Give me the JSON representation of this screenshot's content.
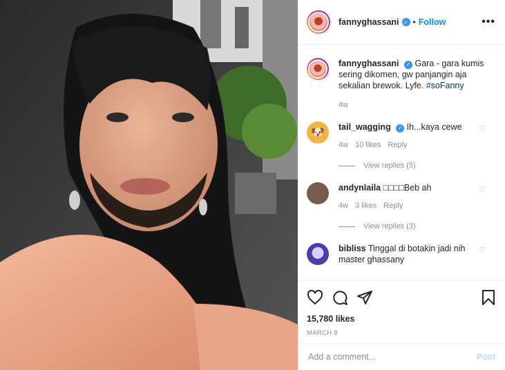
{
  "post": {
    "username": "fannyghassani",
    "follow_label": "Follow",
    "dot": "•",
    "more_icon": "more-options-icon",
    "caption_username": "fannyghassani",
    "caption_text": "Gara - gara kumis sering dikomen, gw panjangin aja sekalian brewok. Lyfe.",
    "caption_hashtag": "#soFanny",
    "caption_time": "4w"
  },
  "comments": [
    {
      "username": "tail_wagging",
      "verified": true,
      "text": "Ih...kaya cewe",
      "time": "4w",
      "likes": "10 likes",
      "reply": "Reply",
      "view_replies": "View replies (5)",
      "avatar_color": "#f2b440"
    },
    {
      "username": "andynlaila",
      "verified": false,
      "text": "□□□□Beb ah",
      "time": "4w",
      "likes": "3 likes",
      "reply": "Reply",
      "view_replies": "View replies (3)",
      "avatar_color": "#7a5a4a"
    },
    {
      "username": "bibliss",
      "verified": false,
      "text": "Tinggal di botakin jadi nih master ghassany",
      "avatar_color": "#4a3ea8"
    }
  ],
  "actions": {
    "likes": "15,780 likes",
    "date": "MARCH 8"
  },
  "add_comment": {
    "placeholder": "Add a comment...",
    "post_label": "Post"
  },
  "colors": {
    "accent": "#0095f6",
    "verified": "#3897f0",
    "post_disabled": "#b2dffc"
  }
}
